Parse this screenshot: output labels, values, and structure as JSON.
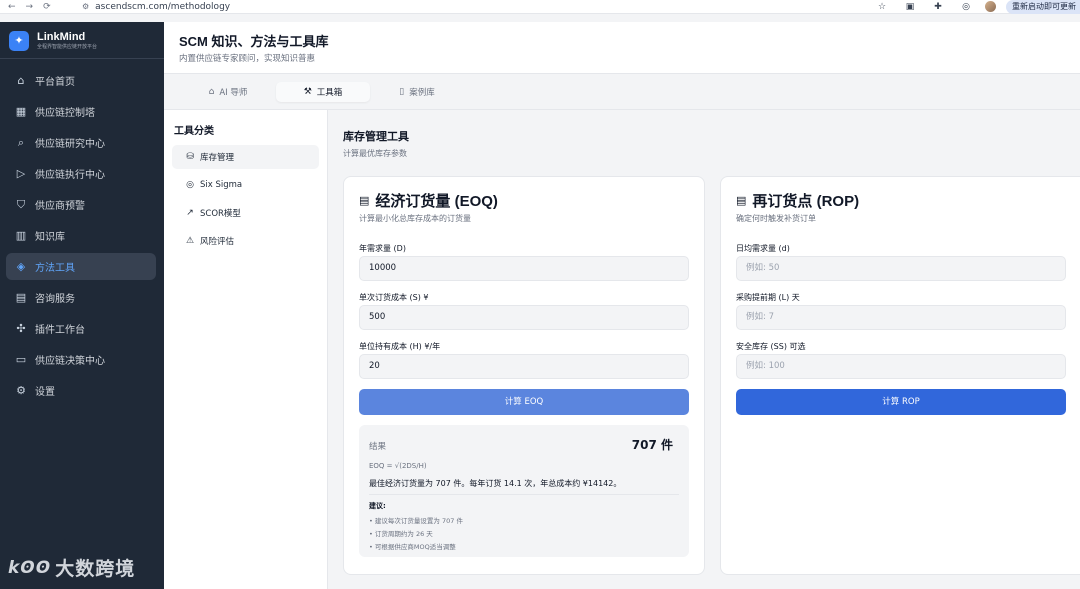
{
  "browser": {
    "url": "ascendscm.com/methodology",
    "update_label": "重新启动即可更新"
  },
  "brand": {
    "name": "LinkMind",
    "tagline": "全程界智能供应链开放平台"
  },
  "sidebar": {
    "items": [
      {
        "label": "平台首页",
        "icon": "home-icon"
      },
      {
        "label": "供应链控制塔",
        "icon": "grid-icon"
      },
      {
        "label": "供应链研究中心",
        "icon": "search-icon"
      },
      {
        "label": "供应链执行中心",
        "icon": "play-icon"
      },
      {
        "label": "供应商预警",
        "icon": "shield-icon"
      },
      {
        "label": "知识库",
        "icon": "book-icon"
      },
      {
        "label": "方法工具",
        "icon": "graduation-cap-icon",
        "active": true
      },
      {
        "label": "咨询服务",
        "icon": "briefcase-icon"
      },
      {
        "label": "插件工作台",
        "icon": "puzzle-icon"
      },
      {
        "label": "供应链决策中心",
        "icon": "monitor-icon"
      },
      {
        "label": "设置",
        "icon": "gear-icon"
      }
    ],
    "watermark": "大数跨境"
  },
  "header": {
    "title": "SCM 知识、方法与工具库",
    "subtitle": "内置供应链专家顾问，实现知识普惠"
  },
  "tabs": [
    {
      "label": "AI 导师",
      "icon": "bot-icon"
    },
    {
      "label": "工具箱",
      "icon": "wrench-icon",
      "active": true
    },
    {
      "label": "案例库",
      "icon": "open-book-icon"
    }
  ],
  "categories": {
    "title": "工具分类",
    "items": [
      {
        "label": "库存管理",
        "icon": "boxes-icon",
        "active": true
      },
      {
        "label": "Six Sigma",
        "icon": "target-icon"
      },
      {
        "label": "SCOR模型",
        "icon": "trend-icon"
      },
      {
        "label": "风险评估",
        "icon": "warning-icon"
      }
    ]
  },
  "main": {
    "title": "库存管理工具",
    "subtitle": "计算最优库存参数"
  },
  "eoq": {
    "title": "经济订货量 (EOQ)",
    "subtitle": "计算最小化总库存成本的订货量",
    "fields": [
      {
        "label": "年需求量 (D)",
        "value": "10000"
      },
      {
        "label": "单次订货成本 (S) ¥",
        "value": "500"
      },
      {
        "label": "单位持有成本 (H) ¥/年",
        "value": "20"
      }
    ],
    "button": "计算 EOQ",
    "result": {
      "label": "结果",
      "value": "707 件",
      "formula": "EOQ = √(2DS/H)",
      "summary": "最佳经济订货量为 707 件。每年订货 14.1 次，年总成本约 ¥14142。",
      "suggestions_title": "建议:",
      "suggestions": [
        "• 建议每次订货量设置为 707 件",
        "• 订货周期约为 26 天",
        "• 可根据供应商MOQ适当调整"
      ]
    }
  },
  "rop": {
    "title": "再订货点 (ROP)",
    "subtitle": "确定何时触发补货订单",
    "fields": [
      {
        "label": "日均需求量 (d)",
        "placeholder": "例如: 50"
      },
      {
        "label": "采购提前期 (L) 天",
        "placeholder": "例如: 7"
      },
      {
        "label": "安全库存 (SS) 可选",
        "placeholder": "例如: 100"
      }
    ],
    "button": "计算 ROP"
  }
}
